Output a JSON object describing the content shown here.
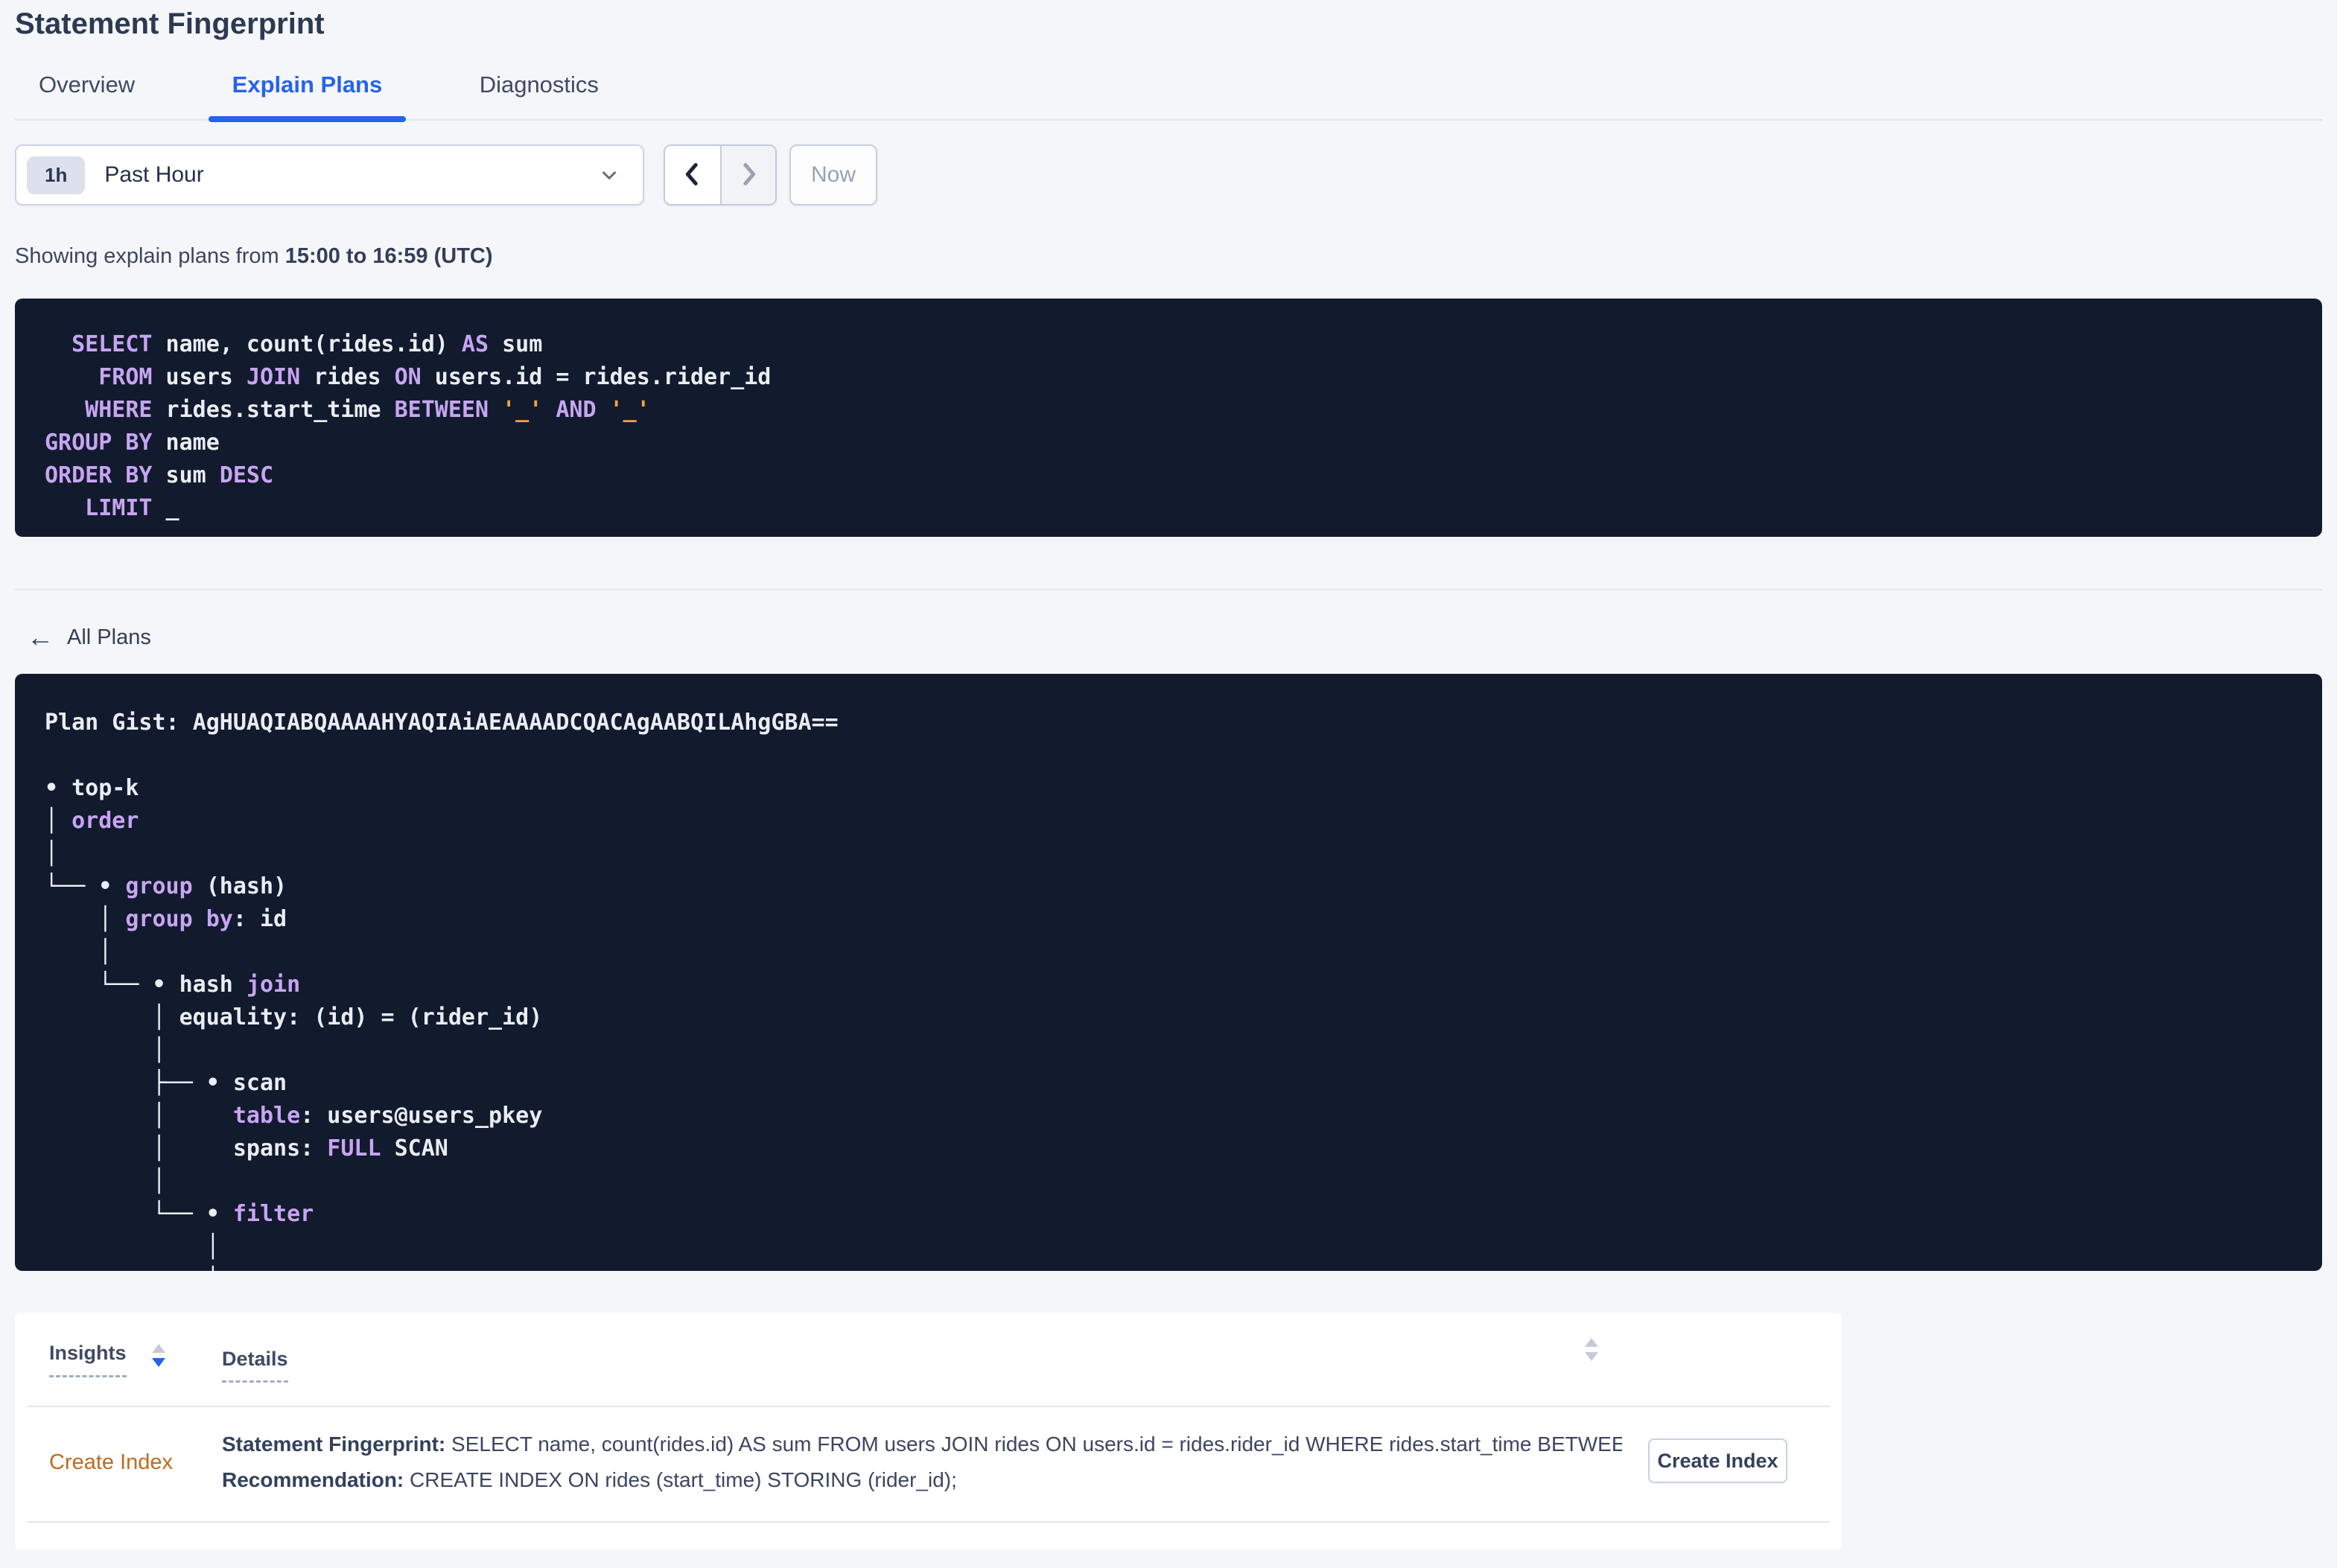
{
  "page": {
    "title": "Statement Fingerprint"
  },
  "tabs": [
    {
      "label": "Overview",
      "active": false
    },
    {
      "label": "Explain Plans",
      "active": true
    },
    {
      "label": "Diagnostics",
      "active": false
    }
  ],
  "time_picker": {
    "badge": "1h",
    "selected": "Past Hour",
    "now_label": "Now"
  },
  "showing": {
    "prefix": "Showing explain plans from ",
    "range": "15:00 to 16:59 (UTC)"
  },
  "sql_box": {
    "lines": [
      [
        [
          "k",
          "  SELECT"
        ],
        [
          "w",
          " name, count(rides.id) "
        ],
        [
          "k",
          "AS"
        ],
        [
          "w",
          " sum"
        ]
      ],
      [
        [
          "k",
          "    FROM"
        ],
        [
          "w",
          " users "
        ],
        [
          "k",
          "JOIN"
        ],
        [
          "w",
          " rides "
        ],
        [
          "k",
          "ON"
        ],
        [
          "w",
          " users.id = rides.rider_id"
        ]
      ],
      [
        [
          "k",
          "   WHERE"
        ],
        [
          "w",
          " rides.start_time "
        ],
        [
          "k",
          "BETWEEN"
        ],
        [
          "w",
          " "
        ],
        [
          "o",
          "'_'"
        ],
        [
          "w",
          " "
        ],
        [
          "k",
          "AND"
        ],
        [
          "w",
          " "
        ],
        [
          "o",
          "'_'"
        ]
      ],
      [
        [
          "k",
          "GROUP BY"
        ],
        [
          "w",
          " name"
        ]
      ],
      [
        [
          "k",
          "ORDER BY"
        ],
        [
          "w",
          " sum "
        ],
        [
          "k",
          "DESC"
        ]
      ],
      [
        [
          "k",
          "   LIMIT"
        ],
        [
          "w",
          " _"
        ]
      ]
    ]
  },
  "all_plans": {
    "label": "All Plans",
    "arrow": "←"
  },
  "plan_box": {
    "gist_label": "Plan Gist: ",
    "gist": "AgHUAQIABQAAAAHYAQIAiAEAAAADCQACAgAABQILAhgGBA==",
    "tree": [
      [
        [
          "w",
          "• top-k"
        ]
      ],
      [
        [
          "w",
          "│ "
        ],
        [
          "k",
          "order"
        ]
      ],
      [
        [
          "w",
          "│"
        ]
      ],
      [
        [
          "w",
          "└── • "
        ],
        [
          "k",
          "group"
        ],
        [
          "w",
          " (hash)"
        ]
      ],
      [
        [
          "w",
          "    │ "
        ],
        [
          "k",
          "group by"
        ],
        [
          "w",
          ": id"
        ]
      ],
      [
        [
          "w",
          "    │"
        ]
      ],
      [
        [
          "w",
          "    └── • hash "
        ],
        [
          "k",
          "join"
        ]
      ],
      [
        [
          "w",
          "        │ equality: (id) = (rider_id)"
        ]
      ],
      [
        [
          "w",
          "        │"
        ]
      ],
      [
        [
          "w",
          "        ├── • scan"
        ]
      ],
      [
        [
          "w",
          "        │     "
        ],
        [
          "k",
          "table"
        ],
        [
          "w",
          ": users@users_pkey"
        ]
      ],
      [
        [
          "w",
          "        │     spans: "
        ],
        [
          "k",
          "FULL"
        ],
        [
          "w",
          " SCAN"
        ]
      ],
      [
        [
          "w",
          "        │"
        ]
      ],
      [
        [
          "w",
          "        └── • "
        ],
        [
          "k",
          "filter"
        ]
      ],
      [
        [
          "w",
          "            │"
        ]
      ],
      [
        [
          "w",
          "            │"
        ]
      ],
      [
        [
          "w",
          "            │"
        ]
      ]
    ]
  },
  "insights": {
    "columns": [
      {
        "label": "Insights"
      },
      {
        "label": "Details"
      }
    ],
    "rows": [
      {
        "insight": "Create Index",
        "fingerprint_label": "Statement Fingerprint:",
        "fingerprint_text": " SELECT name, count(rides.id) AS sum FROM users JOIN rides ON users.id = rides.rider_id WHERE rides.start_time BETWEEN '_…",
        "recommendation_label": "Recommendation:",
        "recommendation_text": " CREATE INDEX ON rides (start_time) STORING (rider_id);",
        "action_label": "Create Index"
      }
    ]
  },
  "colors": {
    "page_bg": "#f5f6fa",
    "accent_blue": "#2563eb",
    "code_bg": "#121a2d",
    "code_text": "#e9edf4",
    "keyword_purple": "#c7a5f2",
    "literal_orange": "#f4a43e",
    "insight_orange": "#bf6b1e"
  }
}
